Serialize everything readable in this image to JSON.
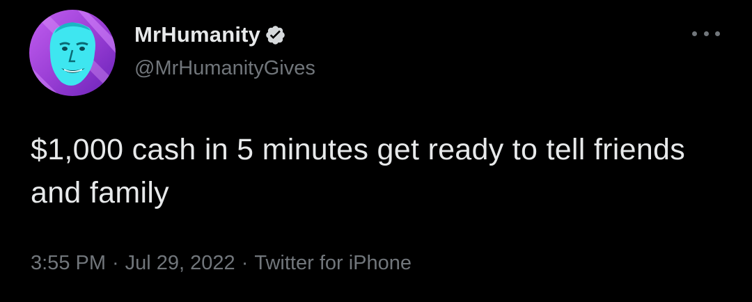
{
  "author": {
    "display_name": "MrHumanity",
    "handle": "@MrHumanityGives",
    "verified": true
  },
  "tweet": {
    "text": "$1,000 cash in 5 minutes get ready to tell friends and family"
  },
  "meta": {
    "time": "3:55 PM",
    "separator": "·",
    "date": "Jul 29, 2022",
    "source": "Twitter for iPhone"
  },
  "icons": {
    "verified": "verified-badge-icon",
    "more": "more-horizontal-icon"
  },
  "colors": {
    "background": "#000000",
    "primary_text": "#e7e9ea",
    "secondary_text": "#71767b",
    "avatar_purple": "#9b3fd6",
    "avatar_cyan": "#3ee6f0"
  }
}
